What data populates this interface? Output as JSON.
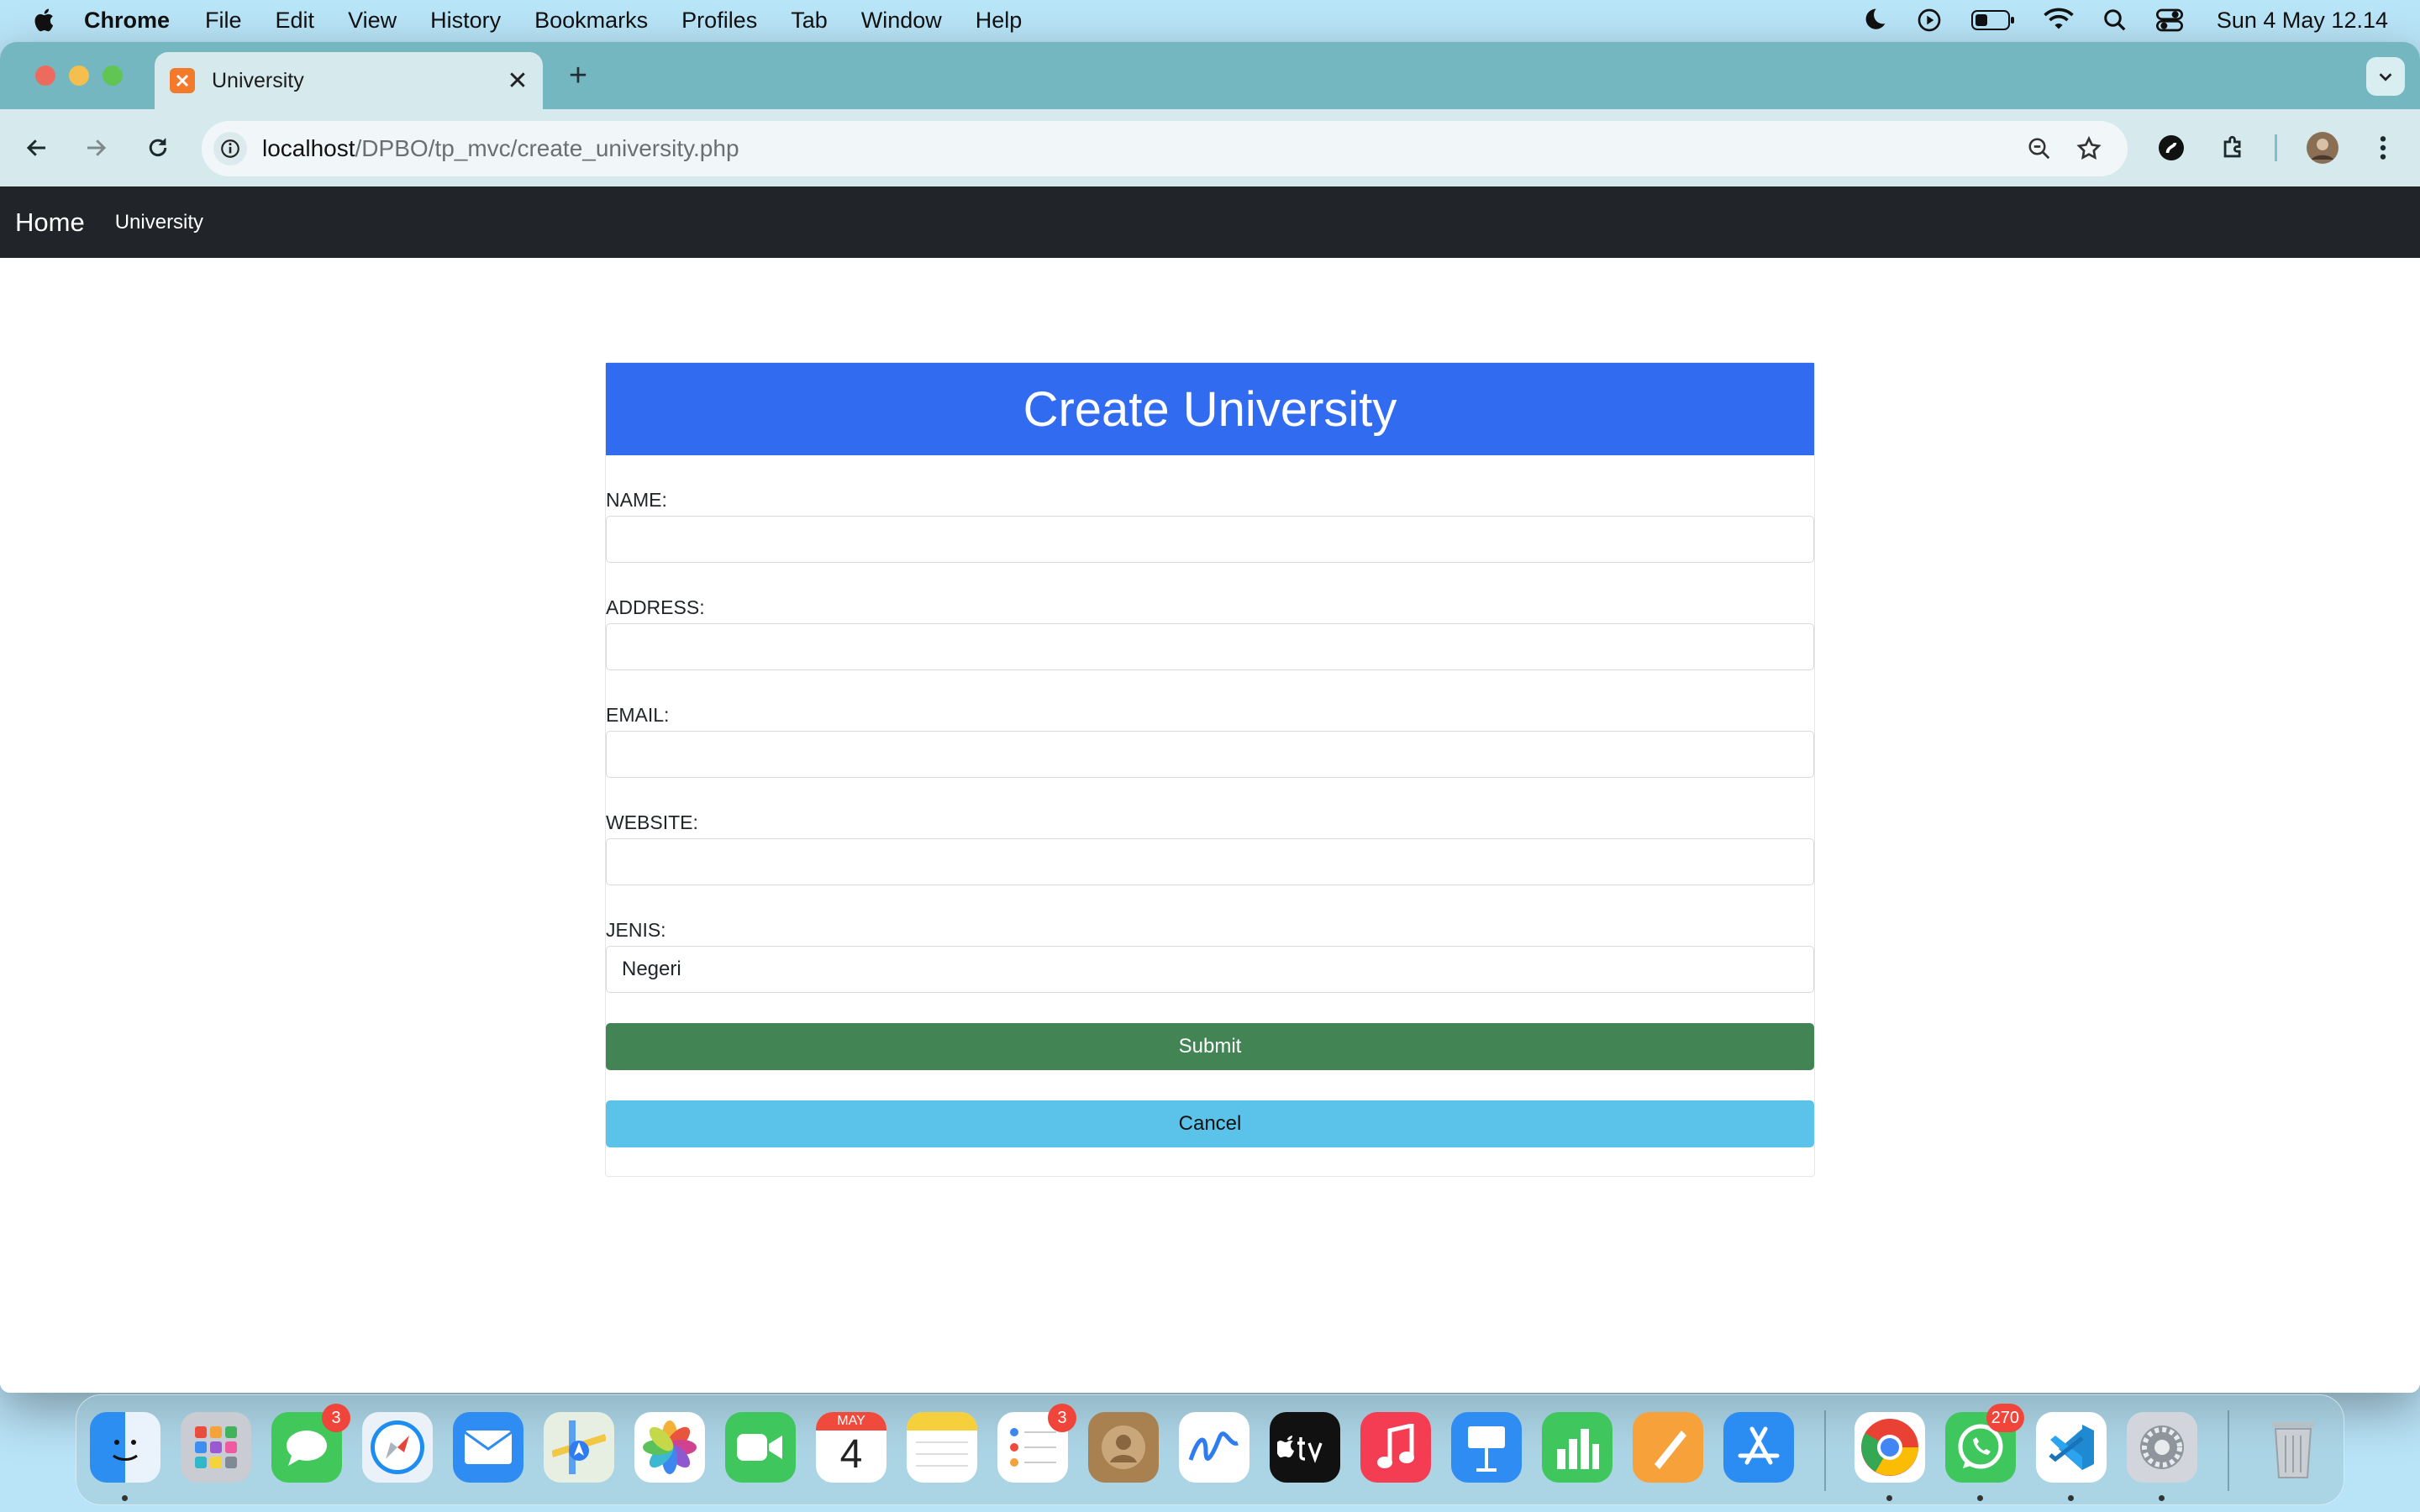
{
  "menubar": {
    "app_name": "Chrome",
    "items": [
      "File",
      "Edit",
      "View",
      "History",
      "Bookmarks",
      "Profiles",
      "Tab",
      "Window",
      "Help"
    ],
    "clock": "Sun 4 May  12.14"
  },
  "browser": {
    "tab_title": "University",
    "url_host": "localhost",
    "url_path": "/DPBO/tp_mvc/create_university.php"
  },
  "navbar": {
    "brand": "Home",
    "links": [
      "University"
    ]
  },
  "form": {
    "title": "Create University",
    "fields": [
      {
        "label": "NAME:",
        "value": ""
      },
      {
        "label": "ADDRESS:",
        "value": ""
      },
      {
        "label": "EMAIL:",
        "value": ""
      },
      {
        "label": "WEBSITE:",
        "value": ""
      },
      {
        "label": "JENIS:",
        "value": "Negeri"
      }
    ],
    "submit_label": "Submit",
    "cancel_label": "Cancel"
  },
  "dock": {
    "calendar_month": "MAY",
    "calendar_day": "4",
    "badges": {
      "messages": "3",
      "reminders": "3",
      "whatsapp": "270"
    }
  },
  "colors": {
    "navbar_bg": "#212529",
    "header_bg": "#316cf0",
    "submit_bg": "#438454",
    "cancel_bg": "#5bc3ea"
  }
}
